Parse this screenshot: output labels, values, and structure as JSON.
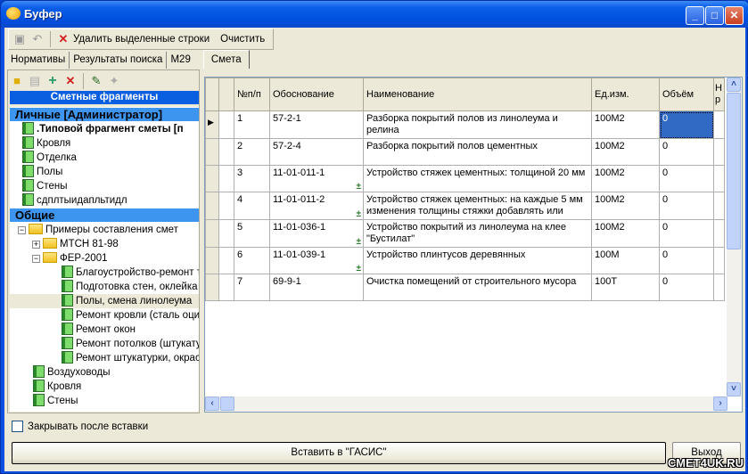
{
  "window": {
    "title": "Буфер",
    "minimize": "_",
    "maximize": "□",
    "close": "✕"
  },
  "toolbar": {
    "delete_label": "Удалить выделенные строки",
    "clear_label": "Очистить"
  },
  "tabs": [
    {
      "label": "Нормативы"
    },
    {
      "label": "Результаты поиска"
    },
    {
      "label": "М29"
    },
    {
      "label": "Смета"
    }
  ],
  "left": {
    "header": "Сметные фрагменты",
    "personal_group": "Личные [Администратор]",
    "personal_items": [
      ".Типовой фрагмент сметы [п",
      "Кровля",
      "Отделка",
      "Полы",
      "Стены",
      "сдплтыидапльтидл"
    ],
    "common_group": "Общие",
    "common_root": "Примеры составления смет",
    "mtsn": "МТСН 81-98",
    "fer": "ФЕР-2001",
    "fer_items": [
      "Благоустройство-ремонт тро",
      "Подготовка стен, оклейка с",
      "Полы, смена линолеума",
      "Ремонт кровли (сталь оцинк",
      "Ремонт окон",
      "Ремонт потолков (штукатурк",
      "Ремонт штукатурки, окраск"
    ],
    "common_items": [
      "Воздуховоды",
      "Кровля",
      "Стены"
    ]
  },
  "grid": {
    "columns": [
      "№п/п",
      "Обоснование",
      "Наименование",
      "Ед.изм.",
      "Объём",
      "Н р"
    ],
    "rows": [
      {
        "n": "1",
        "code": "57-2-1",
        "name": "Разборка покрытий полов из линолеума и релина",
        "unit": "100М2",
        "vol": "0",
        "mark": ""
      },
      {
        "n": "2",
        "code": "57-2-4",
        "name": "Разборка покрытий полов цементных",
        "unit": "100М2",
        "vol": "0",
        "mark": ""
      },
      {
        "n": "3",
        "code": "11-01-011-1",
        "name": "Устройство стяжек цементных: толщиной 20 мм",
        "unit": "100М2",
        "vol": "0",
        "mark": "±"
      },
      {
        "n": "4",
        "code": "11-01-011-2",
        "name": "Устройство стяжек цементных: на каждые 5 мм изменения толщины стяжки добавлять или",
        "unit": "100М2",
        "vol": "0",
        "mark": "±"
      },
      {
        "n": "5",
        "code": "11-01-036-1",
        "name": "Устройство покрытий из линолеума на клее \"Бустилат\"",
        "unit": "100М2",
        "vol": "0",
        "mark": "±"
      },
      {
        "n": "6",
        "code": "11-01-039-1",
        "name": "Устройство плинтусов деревянных",
        "unit": "100М",
        "vol": "0",
        "mark": "±"
      },
      {
        "n": "7",
        "code": "69-9-1",
        "name": "Очистка помещений от строительного мусора",
        "unit": "100Т",
        "vol": "0",
        "mark": ""
      }
    ]
  },
  "footer": {
    "close_after_insert": "Закрывать после вставки",
    "insert_button": "Вставить в \"ГАСИС\"",
    "exit_button": "Выход"
  },
  "watermark": "СМЕТ4UK.RU"
}
